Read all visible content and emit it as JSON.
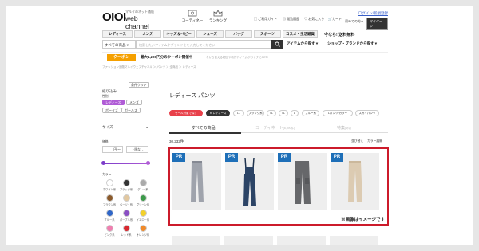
{
  "header": {
    "logo_mark": "OIOI",
    "logo_tagline": "マルイのネット通販",
    "logo_name": "web channel",
    "coordinate_label": "コーディネート",
    "ranking_label": "ランキング",
    "util_guide": "ご利用ガイド",
    "util_history": "閲覧履歴",
    "util_favorite": "お気に入り",
    "util_cart": "カート",
    "login_link": "ログイン/新規登録",
    "first_time_btn": "初めての方へ",
    "mypage_btn": "マイページ"
  },
  "nav": {
    "tabs": [
      "レディース",
      "メンズ",
      "キッズ＆ベビー",
      "シューズ",
      "バッグ",
      "スポーツ",
      "コスメ・生活雑貨"
    ],
    "promo": "今なら!!送料無料"
  },
  "search": {
    "scope": "すべての商品",
    "placeholder": "検索したいアイテムやブランドをを入力してください",
    "item_filter": "アイテムから探す",
    "shop_filter": "ショップ・ブランドから探す"
  },
  "coupon": {
    "badge": "クーポン",
    "text": "最大1,200円分のクーポン開催中",
    "note": "今から使える初回や新作アイテムがおトクにGET!"
  },
  "breadcrumb": "ファッション通販マルイウェブチャネル ＞ パンツ ＞ 全商品 ＞ レディース",
  "sidebar": {
    "filter_heading": "絞り込み",
    "clear_label": "条件クリア",
    "gender_heading": "性別",
    "genders": [
      "レディース",
      "メンズ",
      "ボーイズ",
      "ガールズ"
    ],
    "size_heading": "サイズ",
    "price_heading": "価格",
    "price_from": "円 〜",
    "price_to": "上限なし",
    "color_heading": "カラー",
    "colors": [
      {
        "label": "ホワイト系",
        "hex": "#ffffff"
      },
      {
        "label": "ブラック系",
        "hex": "#333333"
      },
      {
        "label": "グレー系",
        "hex": "#aaaaaa"
      },
      {
        "label": "ブラウン系",
        "hex": "#8b5a2b"
      },
      {
        "label": "ベージュ系",
        "hex": "#e2c8a0"
      },
      {
        "label": "グリーン系",
        "hex": "#3c9a4a"
      },
      {
        "label": "ブルー系",
        "hex": "#2f66c8"
      },
      {
        "label": "パープル系",
        "hex": "#8a4fc4"
      },
      {
        "label": "イエロー系",
        "hex": "#f2d02a"
      },
      {
        "label": "ピンク系",
        "hex": "#f07fb0"
      },
      {
        "label": "レッド系",
        "hex": "#d8282f"
      },
      {
        "label": "オレンジ系",
        "hex": "#f08a2a"
      }
    ]
  },
  "main": {
    "title": "レディース パンツ",
    "chips": [
      "セール対象で探す",
      "レディース",
      "LL",
      "ブラック系",
      "4L",
      "4L",
      "L",
      "ブルー系",
      "Lパンツ/カラー",
      "スカイパンツ"
    ],
    "tab_all": "すべての商品",
    "tab_coord": "コーディネート",
    "tab_coord_count": "(6,590件)",
    "tab_special": "特集",
    "tab_special_count": "(4件)",
    "result_count": "30,232件",
    "sort_label": "並び替え",
    "color_view": "カラー展開",
    "pr_badge": "PR",
    "image_note": "※画像はイメージです"
  }
}
